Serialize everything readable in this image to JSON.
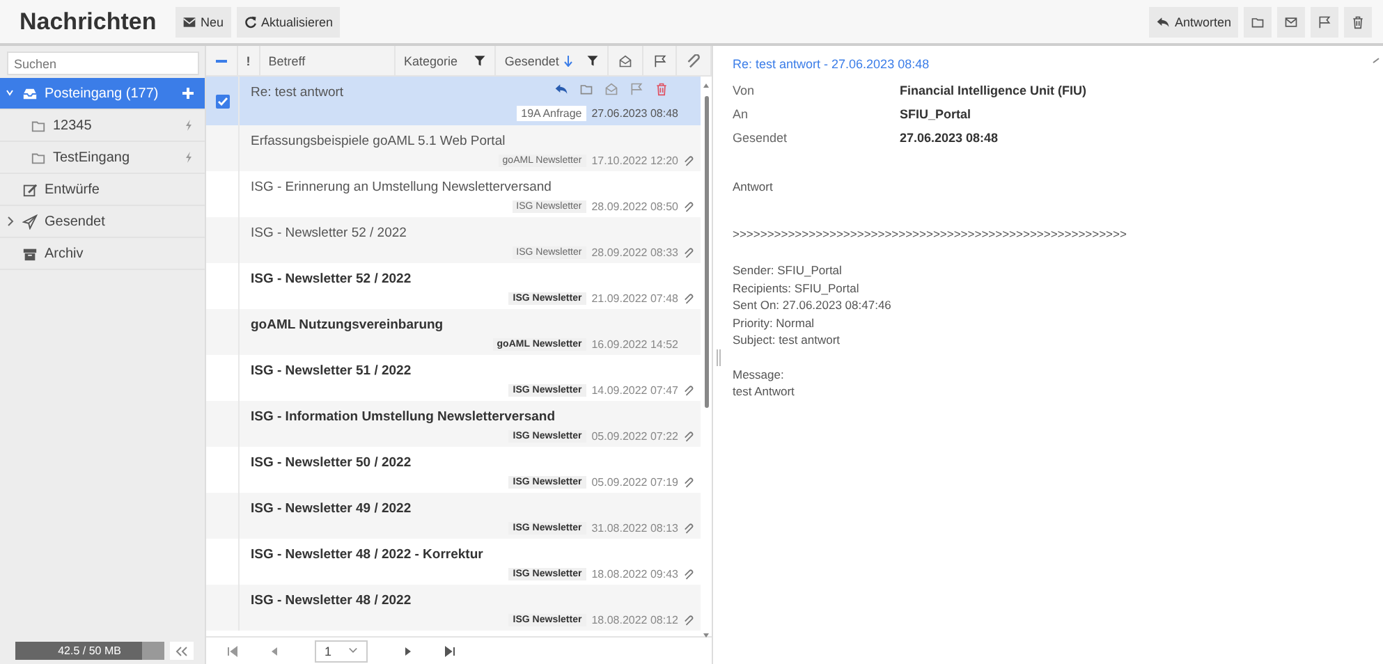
{
  "app_title": "Nachrichten",
  "toolbar": [
    {
      "kind": "mail",
      "label": "Neu"
    },
    {
      "kind": "refresh",
      "label": "Aktualisieren"
    }
  ],
  "preview_toolbar": [
    {
      "kind": "reply",
      "label": "Antworten"
    },
    {
      "kind": "folder"
    },
    {
      "kind": "mail"
    },
    {
      "kind": "flag"
    },
    {
      "kind": "trash"
    }
  ],
  "search": {
    "placeholder": "Suchen"
  },
  "sidebar": {
    "items": [
      {
        "kind": "inbox",
        "label": "Posteingang (177)",
        "selected": true,
        "expanded": true,
        "children": [
          {
            "kind": "folder",
            "label": "12345",
            "selected": false
          },
          {
            "kind": "folder",
            "label": "TestEingang",
            "selected": false
          }
        ]
      },
      {
        "kind": "edit",
        "label": "Entwürfe",
        "selected": false
      },
      {
        "kind": "send",
        "label": "Gesendet",
        "selected": false,
        "expanded": false
      },
      {
        "kind": "archive",
        "label": "Archiv",
        "selected": false
      }
    ]
  },
  "storage": {
    "label": "42.5 / 50 MB",
    "level": 0.85
  },
  "list": {
    "columns": [
      {
        "kind": "priority",
        "label": "!"
      },
      {
        "kind": "text",
        "label": "Betreff"
      },
      {
        "kind": "filter",
        "label": "Kategorie"
      },
      {
        "kind": "sortfilter",
        "label": "Gesendet"
      }
    ],
    "rows": [
      {
        "subject": "Re: test antwort",
        "category": "19A Anfrage",
        "date": "27.06.2023 08:48",
        "unread": false,
        "selected": true,
        "attachment": false
      },
      {
        "subject": "Erfassungsbeispiele goAML 5.1 Web Portal",
        "category": "goAML Newsletter",
        "date": "17.10.2022 12:20",
        "unread": false,
        "selected": false,
        "attachment": true
      },
      {
        "subject": "ISG - Erinnerung an Umstellung Newsletterversand",
        "category": "ISG Newsletter",
        "date": "28.09.2022 08:50",
        "unread": false,
        "selected": false,
        "attachment": true
      },
      {
        "subject": "ISG - Newsletter 52 / 2022",
        "category": "ISG Newsletter",
        "date": "28.09.2022 08:33",
        "unread": false,
        "selected": false,
        "attachment": true
      },
      {
        "subject": "ISG - Newsletter 52 / 2022",
        "category": "ISG Newsletter",
        "date": "21.09.2022 07:48",
        "unread": true,
        "selected": false,
        "attachment": true
      },
      {
        "subject": "goAML Nutzungsvereinbarung",
        "category": "goAML Newsletter",
        "date": "16.09.2022 14:52",
        "unread": true,
        "selected": false,
        "attachment": false
      },
      {
        "subject": "ISG - Newsletter 51 / 2022",
        "category": "ISG Newsletter",
        "date": "14.09.2022 07:47",
        "unread": true,
        "selected": false,
        "attachment": true
      },
      {
        "subject": "ISG - Information Umstellung Newsletterversand",
        "category": "ISG Newsletter",
        "date": "05.09.2022 07:22",
        "unread": true,
        "selected": false,
        "attachment": true
      },
      {
        "subject": "ISG - Newsletter 50 / 2022",
        "category": "ISG Newsletter",
        "date": "05.09.2022 07:19",
        "unread": true,
        "selected": false,
        "attachment": true
      },
      {
        "subject": "ISG - Newsletter 49 / 2022",
        "category": "ISG Newsletter",
        "date": "31.08.2022 08:13",
        "unread": true,
        "selected": false,
        "attachment": true
      },
      {
        "subject": "ISG - Newsletter 48 / 2022 - Korrektur",
        "category": "ISG Newsletter",
        "date": "18.08.2022 09:43",
        "unread": true,
        "selected": false,
        "attachment": true
      },
      {
        "subject": "ISG - Newsletter 48 / 2022",
        "category": "ISG Newsletter",
        "date": "18.08.2022 08:12",
        "unread": true,
        "selected": false,
        "attachment": true
      }
    ],
    "pager": {
      "page": "1"
    }
  },
  "preview": {
    "title": "Re: test antwort - 27.06.2023 08:48",
    "fields": [
      {
        "label": "Von",
        "value": "Financial Intelligence Unit (FIU)"
      },
      {
        "label": "An",
        "value": "SFIU_Portal"
      },
      {
        "label": "Gesendet",
        "value": "27.06.2023 08:48"
      }
    ],
    "body": [
      [
        "Antwort"
      ],
      [
        ">>>>>>>>>>>>>>>>>>>>>>>>>>>>>>>>>>>>>>>>>>>>>>>>>>>>>>>>>"
      ],
      [
        "Sender: SFIU_Portal",
        "Recipients: SFIU_Portal",
        "Sent On: 27.06.2023 08:47:46",
        "Priority: Normal",
        "Subject: test antwort"
      ],
      [
        "Message:",
        "test Antwort"
      ]
    ]
  }
}
